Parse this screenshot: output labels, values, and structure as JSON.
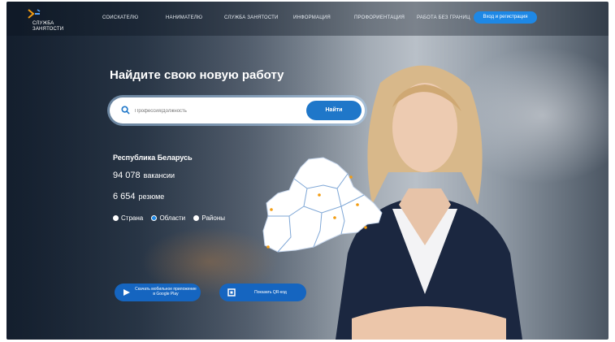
{
  "brand": {
    "logo_text": "СЛУЖБА ЗАНЯТОСТИ",
    "accent": "#1e88e5",
    "logo_orange": "#f39c12",
    "logo_blue": "#4fa3ff"
  },
  "nav": {
    "items": [
      "СОИСКАТЕЛЮ",
      "НАНИМАТЕЛЮ",
      "СЛУЖБА ЗАНЯТОСТИ",
      "ИНФОРМАЦИЯ",
      "ПРОФОРИЕНТАЦИЯ",
      "РАБОТА БЕЗ ГРАНИЦ"
    ],
    "login_label": "Вход и регистрация"
  },
  "hero": {
    "title": "Найдите свою новую работу",
    "search_placeholder": "Профессия/Должность",
    "search_button": "Найти"
  },
  "stats": {
    "region": "Республика Беларусь",
    "vacancies_count": "94 078",
    "vacancies_label": "вакансии",
    "resumes_count": "6 654",
    "resumes_label": "резюме"
  },
  "view_options": [
    {
      "label": "Страна",
      "selected": false
    },
    {
      "label": "Области",
      "selected": true
    },
    {
      "label": "Районы",
      "selected": false
    }
  ],
  "actions": {
    "google_play": "Скачать мобильное приложение в Google Play",
    "qr": "Показать QR-код"
  }
}
